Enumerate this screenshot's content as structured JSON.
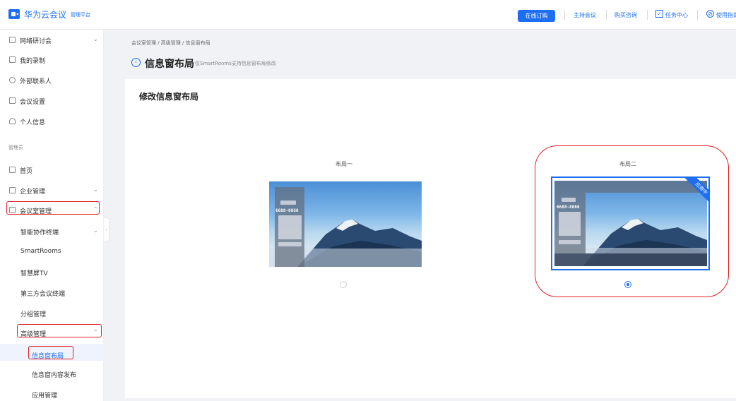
{
  "header": {
    "app_title": "华为云会议",
    "app_subtitle": "管理平台",
    "buy_button": "在线订购",
    "links": [
      "主持会议",
      "购买咨询",
      "任务中心",
      "使用指南"
    ]
  },
  "sidebar": {
    "top_items": [
      {
        "label": "网络研讨会",
        "has_chevron": true
      },
      {
        "label": "我的录制"
      },
      {
        "label": "外部联系人"
      },
      {
        "label": "会议设置"
      },
      {
        "label": "个人信息"
      }
    ],
    "group_label": "管理员",
    "admin_items": [
      {
        "label": "首页"
      },
      {
        "label": "企业管理",
        "has_chevron": true
      },
      {
        "label": "会议室管理",
        "has_chevron": true,
        "expanded": true
      }
    ],
    "room_sub_items": [
      "智能协作终端",
      "SmartRooms",
      "智慧屏TV",
      "第三方会议终端",
      "分组管理",
      "高级管理"
    ],
    "advanced_sub_items": [
      "信息窗布局",
      "信息窗内容发布",
      "应用管理"
    ],
    "active_item": "信息窗布局",
    "chevron_down": "⌄",
    "chevron_up": "⌃"
  },
  "main": {
    "breadcrumb": "会议室管理 / 高级管理 / 信息窗布局",
    "page_title": "信息窗布局",
    "page_subtitle": "仅SmartRooms支持信息窗布局修改",
    "card_title": "修改信息窗布局",
    "layouts": [
      {
        "label": "布局一",
        "selected": false,
        "number": "6688-8866"
      },
      {
        "label": "布局二",
        "selected": true,
        "number": "6688-8866",
        "badge": "应用中"
      }
    ]
  },
  "colors": {
    "brand": "#1d6ef2",
    "annotation": "#e02020"
  }
}
